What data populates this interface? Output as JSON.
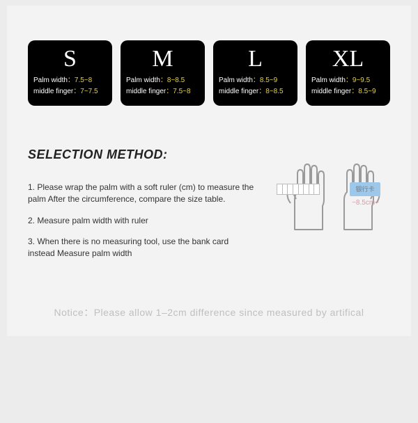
{
  "sizes": [
    {
      "letter": "S",
      "palm_label": "Palm width",
      "palm_value": "7.5~8",
      "finger_label": "middle finger",
      "finger_value": "7~7.5"
    },
    {
      "letter": "M",
      "palm_label": "Palm width",
      "palm_value": "8~8.5",
      "finger_label": "middle finger",
      "finger_value": "7.5~8"
    },
    {
      "letter": "L",
      "palm_label": "Palm width",
      "palm_value": "8.5~9",
      "finger_label": "middle finger",
      "finger_value": "8~8.5"
    },
    {
      "letter": "XL",
      "palm_label": "Palm width",
      "palm_value": "9~9.5",
      "finger_label": "middle finger",
      "finger_value": "8.5~9"
    }
  ],
  "method": {
    "title": "SELECTION METHOD:",
    "steps": [
      "1. Please wrap the palm with a soft ruler (cm) to measure the palm After the circumference, compare the size table.",
      "2. Measure palm width with ruler",
      "3. When there is no measuring tool, use the bank card instead Measure palm width"
    ]
  },
  "illustration": {
    "card_text": "银行卡",
    "width_text": "~8.5cm~"
  },
  "notice": "Notice：Please allow 1–2cm difference since measured by artifical"
}
